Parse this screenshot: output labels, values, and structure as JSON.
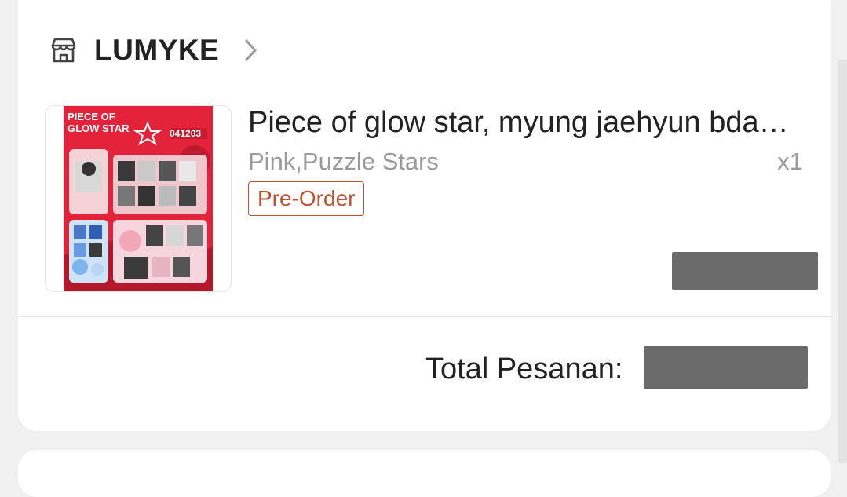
{
  "store": {
    "name": "LUMYKE"
  },
  "product": {
    "title": "Piece of glow star, myung jaehyun bda…",
    "variant": "Pink,Puzzle Stars",
    "quantity": "x1",
    "badge": "Pre-Order",
    "thumbnail": {
      "title_line1": "PIECE OF",
      "title_line2": "GLOW STAR",
      "code": "041203"
    }
  },
  "summary": {
    "total_label": "Total Pesanan:"
  },
  "colors": {
    "accent": "#c1502e",
    "redaction": "#6b6b6b",
    "thumbnail_red": "#e3233a"
  },
  "icons": {
    "store": "store-icon",
    "chevron": "chevron-right-icon"
  }
}
